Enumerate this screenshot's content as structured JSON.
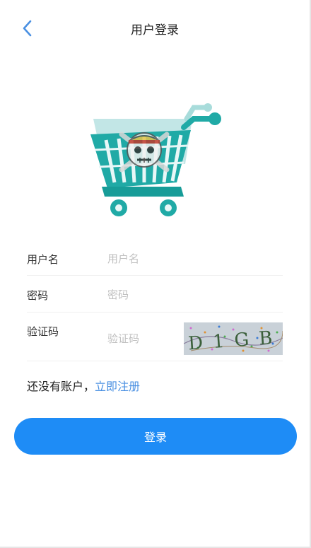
{
  "header": {
    "title": "用户登录",
    "back_icon": "chevron-left-icon"
  },
  "logo": {
    "icon": "shopping-cart-skull-logo"
  },
  "form": {
    "username": {
      "label": "用户名",
      "placeholder": "用户名",
      "value": ""
    },
    "password": {
      "label": "密码",
      "placeholder": "密码",
      "value": ""
    },
    "captcha": {
      "label": "验证码",
      "placeholder": "验证码",
      "value": ""
    }
  },
  "captcha_image": {
    "text": "D1GB"
  },
  "register": {
    "prompt": "还没有账户，",
    "link": "立即注册"
  },
  "login_button": {
    "label": "登录"
  },
  "colors": {
    "accent": "#1e8cf6",
    "link": "#4a90e2",
    "back_icon": "#4a90e2",
    "cart": "#20aaa6"
  }
}
